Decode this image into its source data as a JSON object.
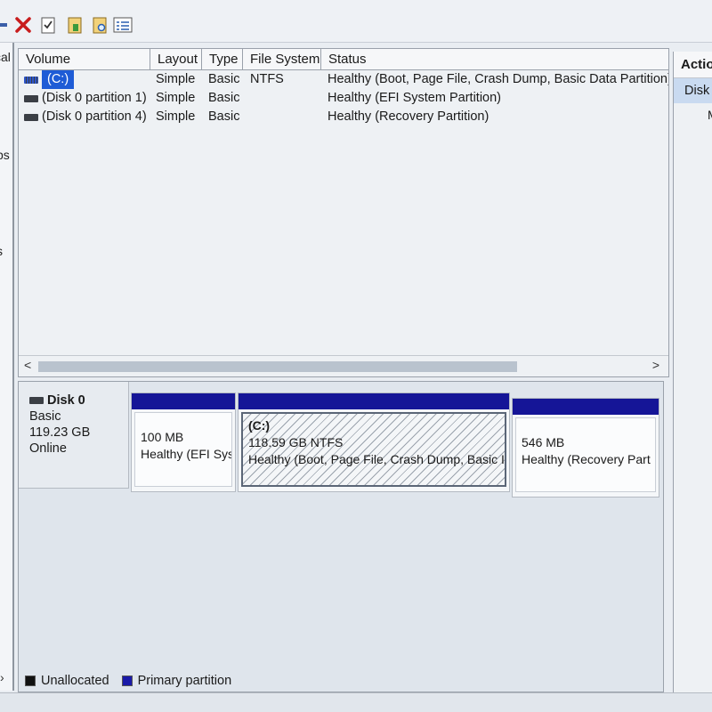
{
  "toolbar": {
    "icons": [
      "bar-icon",
      "delete-icon",
      "check-doc-icon",
      "properties-icon",
      "search-doc-icon",
      "list-icon"
    ]
  },
  "left_pane": {
    "fragments": [
      "cal",
      "ps",
      "s"
    ]
  },
  "volume_table": {
    "columns": [
      "Volume",
      "Layout",
      "Type",
      "File System",
      "Status"
    ],
    "rows": [
      {
        "volume": "(C:)",
        "layout": "Simple",
        "type": "Basic",
        "fs": "NTFS",
        "status": "Healthy (Boot, Page File, Crash Dump, Basic Data Partition)"
      },
      {
        "volume": "(Disk 0 partition 1)",
        "layout": "Simple",
        "type": "Basic",
        "fs": "",
        "status": "Healthy (EFI System Partition)"
      },
      {
        "volume": "(Disk 0 partition 4)",
        "layout": "Simple",
        "type": "Basic",
        "fs": "",
        "status": "Healthy (Recovery Partition)"
      }
    ],
    "scroll_left": "<",
    "scroll_right": ">"
  },
  "disk": {
    "name": "Disk 0",
    "kind": "Basic",
    "size": "119.23 GB",
    "state": "Online",
    "partitions": [
      {
        "title": "",
        "size": "100 MB",
        "status": "Healthy (EFI Sys"
      },
      {
        "title": "(C:)",
        "size": "118.59 GB NTFS",
        "status": "Healthy (Boot, Page File, Crash Dump, Basic I"
      },
      {
        "title": "",
        "size": "546 MB",
        "status": "Healthy (Recovery Part"
      }
    ]
  },
  "legend": {
    "unallocated": "Unallocated",
    "primary": "Primary partition"
  },
  "actions": {
    "header": "Actio",
    "item": "Disk",
    "extra": "M"
  },
  "colors": {
    "partition_bar": "#151597",
    "selection": "#1e5cd6",
    "unallocated": "#111111",
    "primary": "#1a1aa8"
  }
}
